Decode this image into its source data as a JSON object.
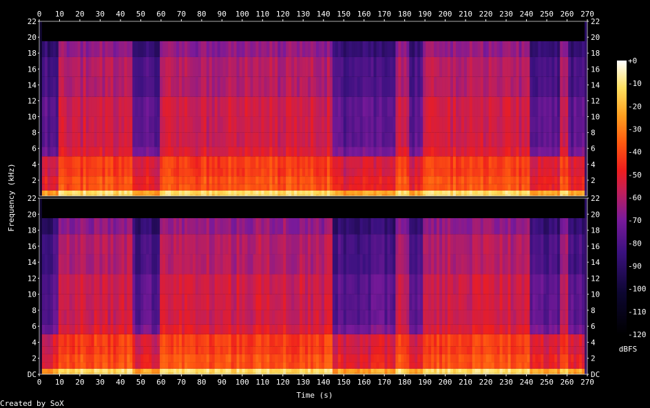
{
  "chart_data": {
    "type": "heatmap",
    "subtype": "spectrogram",
    "channels": 2,
    "x": {
      "label": "Time (s)",
      "range": [
        0,
        270
      ],
      "ticks": [
        0,
        10,
        20,
        30,
        40,
        50,
        60,
        70,
        80,
        90,
        100,
        110,
        120,
        130,
        140,
        150,
        160,
        170,
        180,
        190,
        200,
        210,
        220,
        230,
        240,
        250,
        260,
        270
      ]
    },
    "y": {
      "label": "Frequency (kHz)",
      "range": [
        0,
        22
      ],
      "ticks": [
        0,
        2,
        4,
        6,
        8,
        10,
        12,
        14,
        16,
        18,
        20,
        22
      ],
      "tick_labels": [
        "DC",
        "2",
        "4",
        "6",
        "8",
        "10",
        "12",
        "14",
        "16",
        "18",
        "20",
        "22"
      ]
    },
    "colorbar": {
      "label": "dBFS",
      "range": [
        -120,
        0
      ],
      "ticks": [
        0,
        -10,
        -20,
        -30,
        -40,
        -50,
        -60,
        -70,
        -80,
        -90,
        -100,
        -110,
        -120
      ],
      "tick_labels": [
        "+0",
        "-10",
        "-20",
        "-30",
        "-40",
        "-50",
        "-60",
        "-70",
        "-80",
        "-90",
        "-100",
        "-110",
        "-120"
      ]
    },
    "content_max_khz": 20.3,
    "quiet_segments_s": [
      [
        0.5,
        3
      ],
      [
        3,
        9
      ],
      [
        46,
        52
      ],
      [
        53,
        60
      ],
      [
        145,
        160
      ],
      [
        160,
        175
      ],
      [
        182,
        189
      ],
      [
        241,
        256
      ],
      [
        260,
        268
      ]
    ],
    "loud_segments_s": [
      [
        9,
        46
      ],
      [
        60,
        82
      ],
      [
        82,
        145
      ],
      [
        189,
        241
      ]
    ]
  },
  "colors": {
    "background": "#000000",
    "text": "#ffffff"
  },
  "footer": {
    "text": "Created by SoX"
  }
}
